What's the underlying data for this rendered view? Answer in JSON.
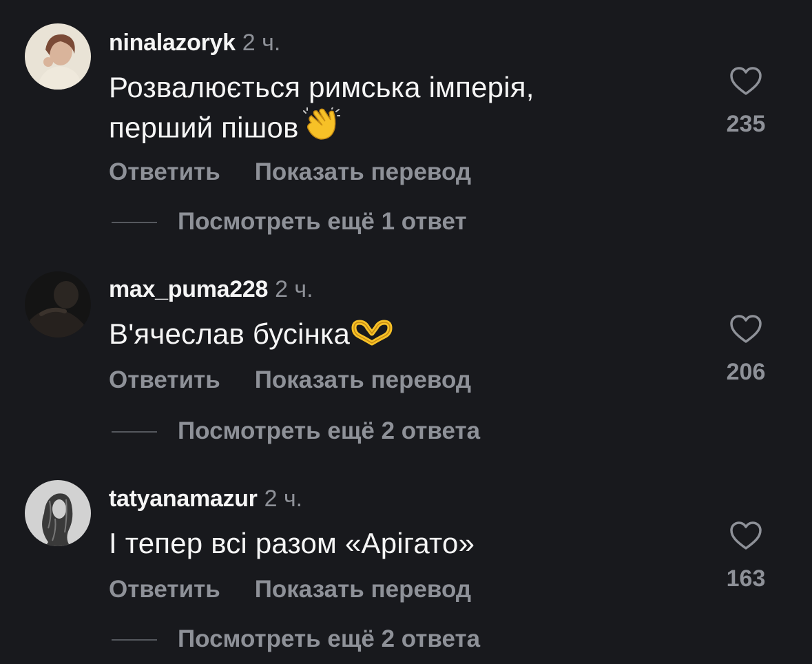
{
  "colors": {
    "background": "#18191d",
    "primary_text": "#f5f5f5",
    "secondary_text": "#8e9198",
    "divider": "#55585e"
  },
  "comments": [
    {
      "username": "ninalazoryk",
      "time": "2 ч.",
      "text_lines": [
        "Розвалюється римська імперія,",
        "перший пішов"
      ],
      "emoji": "clapping-hands-emoji",
      "reply_label": "Ответить",
      "translate_label": "Показать перевод",
      "view_replies_label": "Посмотреть ещё 1 ответ",
      "likes": "235",
      "like_icon": "heart-outline-icon"
    },
    {
      "username": "max_puma228",
      "time": "2 ч.",
      "text_lines": [
        "В'ячеслав бусінка"
      ],
      "emoji": "heart-hands-emoji",
      "reply_label": "Ответить",
      "translate_label": "Показать перевод",
      "view_replies_label": "Посмотреть ещё 2 ответа",
      "likes": "206",
      "like_icon": "heart-outline-icon"
    },
    {
      "username": "tatyanamazur",
      "time": "2 ч.",
      "text_lines": [
        "І тепер всі разом «Арігато»"
      ],
      "emoji": "",
      "reply_label": "Ответить",
      "translate_label": "Показать перевод",
      "view_replies_label": "Посмотреть ещё 2 ответа",
      "likes": "163",
      "like_icon": "heart-outline-icon"
    }
  ]
}
